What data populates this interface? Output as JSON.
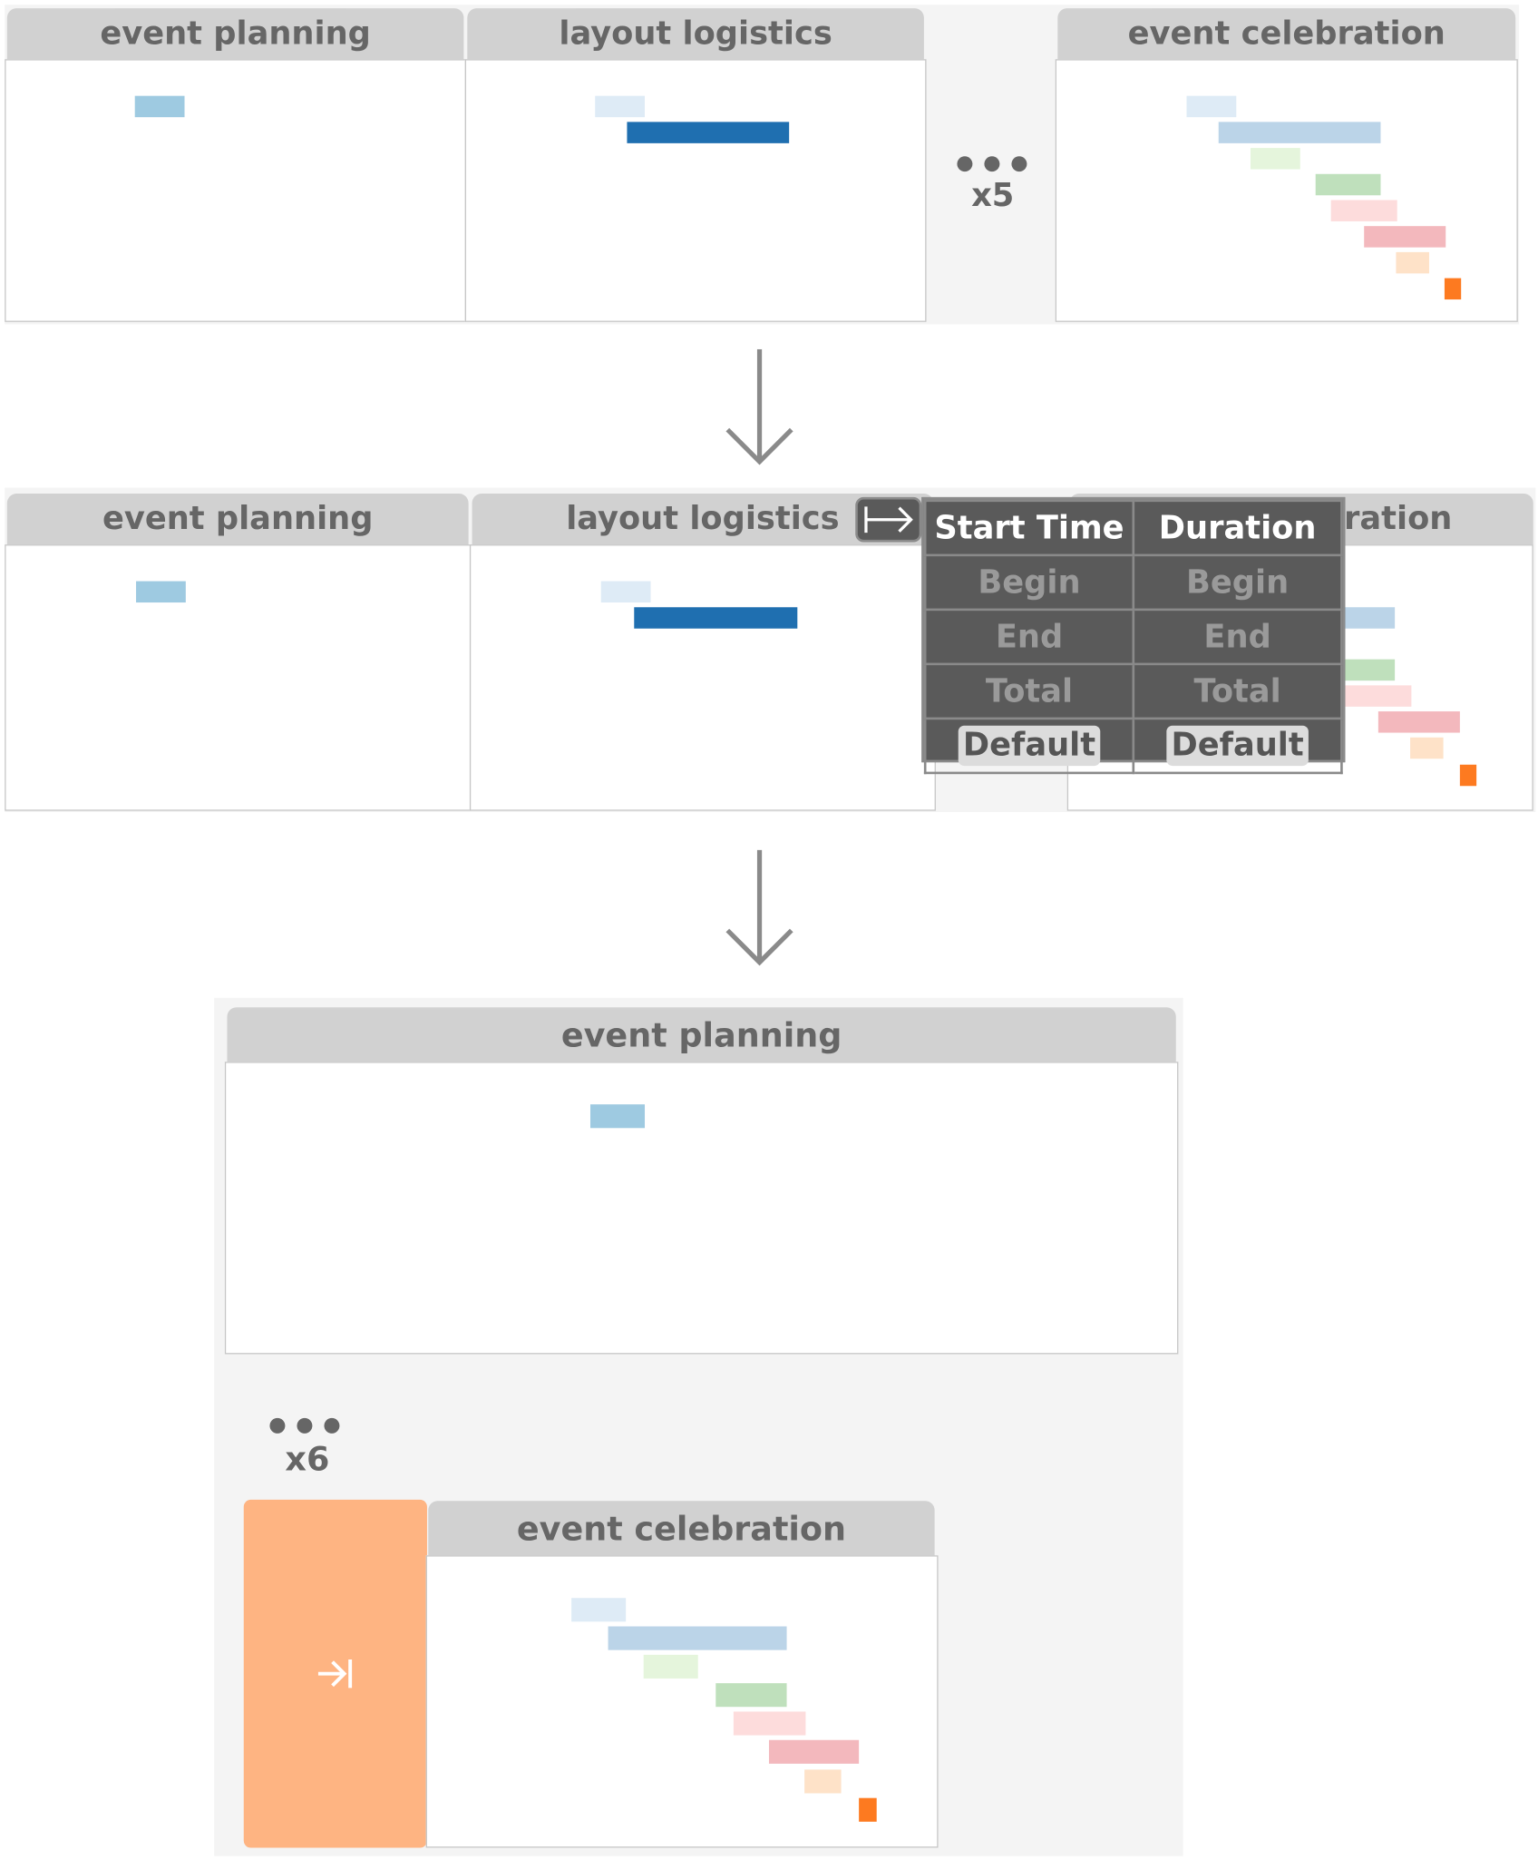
{
  "panels": {
    "planning": "event planning",
    "logistics": "layout logistics",
    "celebration": "event celebration",
    "celebration_clipped": "ration"
  },
  "collapsed": {
    "row1_count": "x5",
    "row3_count": "x6"
  },
  "menu": {
    "columns": [
      "Start Time",
      "Duration"
    ],
    "rows": [
      [
        "Begin",
        "Begin"
      ],
      [
        "End",
        "End"
      ],
      [
        "Total",
        "Total"
      ],
      [
        "Default",
        "Default"
      ]
    ]
  },
  "colors": {
    "blue_light": "#deebf6",
    "blue_mid": "#9ecae1",
    "blue_dark": "#1f6fb0",
    "blue_pale": "#bbd4e8",
    "green_light": "#e5f5dc",
    "green_mid": "#bfe0bc",
    "pink_light": "#fddcdc",
    "pink_mid": "#f3b8bd",
    "peach": "#fee2c8",
    "orange": "#fd7a20",
    "expand_bg": "#feb482"
  },
  "icons": {
    "expand": "arrow-right-from-bar-icon",
    "collapse": "arrow-right-to-bar-icon",
    "flow": "arrow-down-icon"
  }
}
